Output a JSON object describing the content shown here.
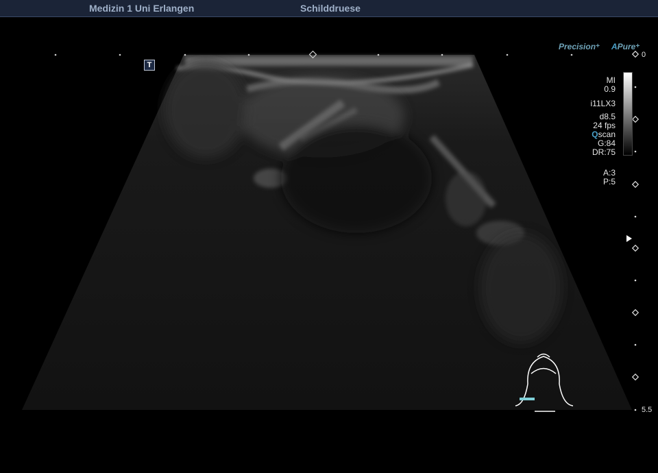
{
  "header": {
    "institution": "Medizin 1 Uni Erlangen",
    "exam": "Schilddruese"
  },
  "image_markers": {
    "t_marker": "T"
  },
  "branding": {
    "precision": "Precision",
    "apure_a": "A",
    "apure": "Pure",
    "plus": "+"
  },
  "params": {
    "mi_label": "MI",
    "mi_value": "0.9",
    "probe": "i11LX3",
    "depth": "d8.5",
    "fps": "24 fps",
    "qscan_q": "Q",
    "qscan": "scan",
    "gain": "G:84",
    "dynamic_range": "DR:75",
    "a": "A:3",
    "p": "P:5"
  },
  "depth_scale": {
    "top": "0",
    "bottom": "5.5"
  },
  "bodymark": {
    "icon": "neck-bodymark-icon",
    "probe_color": "#7fd0d8"
  },
  "colors": {
    "header_bg": "#1b2437",
    "header_text": "#9fb0c8",
    "accent": "#4aa0c8"
  }
}
